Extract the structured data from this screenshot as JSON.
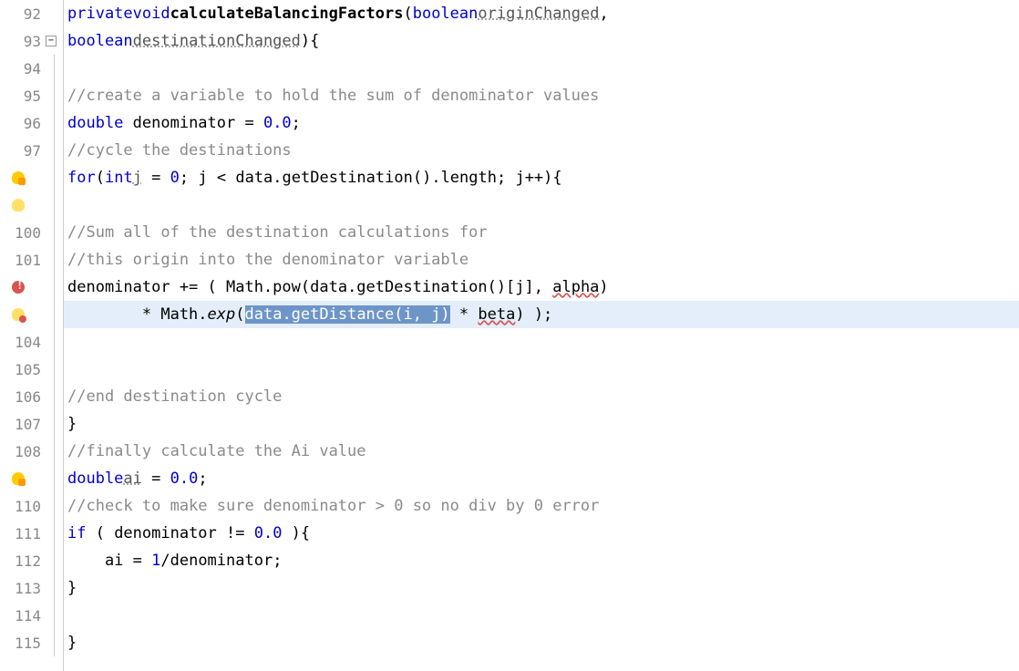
{
  "lines": {
    "l92": {
      "num": "92",
      "private": "private",
      "void": "void",
      "mname": "calculateBalancingFactors",
      "lparen": "(",
      "boolean": "boolean",
      "param1": "originChanged",
      "comma": ","
    },
    "l93": {
      "num": "93",
      "boolean": "boolean",
      "param2": "destinationChanged",
      "rparenBrace": "){"
    },
    "l94": {
      "num": "94"
    },
    "l95": {
      "num": "95",
      "comment": "//create a variable to hold the sum of denominator values"
    },
    "l96": {
      "num": "96",
      "double": "double",
      "decl": " denominator = ",
      "zero": "0.0",
      "semi": ";"
    },
    "l97": {
      "num": "97",
      "comment": "//cycle the destinations"
    },
    "l98": {
      "for": "for",
      "lparen": "(",
      "int": "int",
      "j": "j",
      "eq": " = ",
      "zero": "0",
      "semi1": "; ",
      "jlt": "j < ",
      "data": "data",
      "dot1": ".",
      "getDest": "getDestination",
      "parenDot": "().",
      "length": "length",
      "semi2": "; j++){"
    },
    "l99": {},
    "l100": {
      "num": "100",
      "comment": "//Sum all of the destination calculations for"
    },
    "l101": {
      "num": "101",
      "comment": "//this origin into the denominator variable"
    },
    "l102": {
      "prefix": "denominator += ( Math.pow(",
      "data": "data",
      "mid": ".getDestination()[j], ",
      "alpha": "alpha",
      "close": ")"
    },
    "l103": {
      "prefix": "        * Math.",
      "exp": "exp",
      "lparen": "(",
      "sel": "data.getDistance(i, j)",
      "mid": " * ",
      "beta": "beta",
      "close": ") );"
    },
    "l104": {
      "num": "104"
    },
    "l105": {
      "num": "105"
    },
    "l106": {
      "num": "106",
      "comment": "//end destination cycle"
    },
    "l107": {
      "num": "107",
      "brace": "}"
    },
    "l108": {
      "num": "108",
      "comment": "//finally calculate the Ai value"
    },
    "l109": {
      "double": "double",
      "ai": "ai",
      "eq": " = ",
      "zero": "0.0",
      "semi": ";"
    },
    "l110": {
      "num": "110",
      "comment": "//check to make sure denominator > 0 so no div by 0 error"
    },
    "l111": {
      "num": "111",
      "if": "if",
      "cond": " ( denominator != ",
      "zero": "0.0",
      "brace": " ){"
    },
    "l112": {
      "num": "112",
      "body": "    ai = ",
      "one": "1",
      "rest": "/denominator;"
    },
    "l113": {
      "num": "113",
      "brace": "}"
    },
    "l114": {
      "num": "114"
    },
    "l115": {
      "num": "115",
      "brace": "}"
    }
  }
}
